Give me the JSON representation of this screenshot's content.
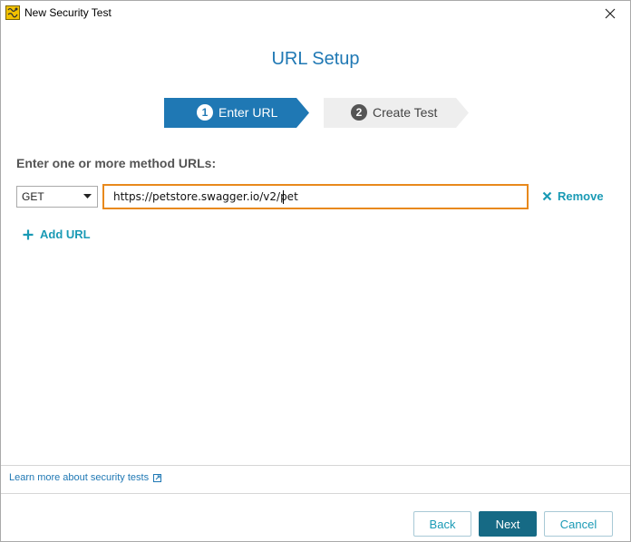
{
  "window": {
    "title": "New Security Test"
  },
  "page": {
    "title": "URL Setup"
  },
  "steps": [
    {
      "number": "1",
      "label": "Enter URL",
      "active": true
    },
    {
      "number": "2",
      "label": "Create Test",
      "active": false
    }
  ],
  "form": {
    "label": "Enter one or more method URLs:",
    "method": "GET",
    "url": "https://petstore.swagger.io/v2/pet",
    "remove_label": "Remove",
    "add_url_label": "Add URL"
  },
  "footer": {
    "learn_more": "Learn more about security tests",
    "back_label": "Back",
    "next_label": "Next",
    "cancel_label": "Cancel"
  },
  "colors": {
    "accent": "#1f78b4",
    "active_step": "#1f78b4",
    "inactive_step": "#eeeeee",
    "input_focus": "#e8891c",
    "link": "#1a9ab5",
    "primary_button": "#166a85"
  },
  "icons": {
    "app": "security-test-app-icon",
    "close": "close-icon",
    "dropdown": "chevron-down-icon",
    "remove": "x-icon",
    "add": "plus-icon",
    "external": "external-link-icon"
  }
}
